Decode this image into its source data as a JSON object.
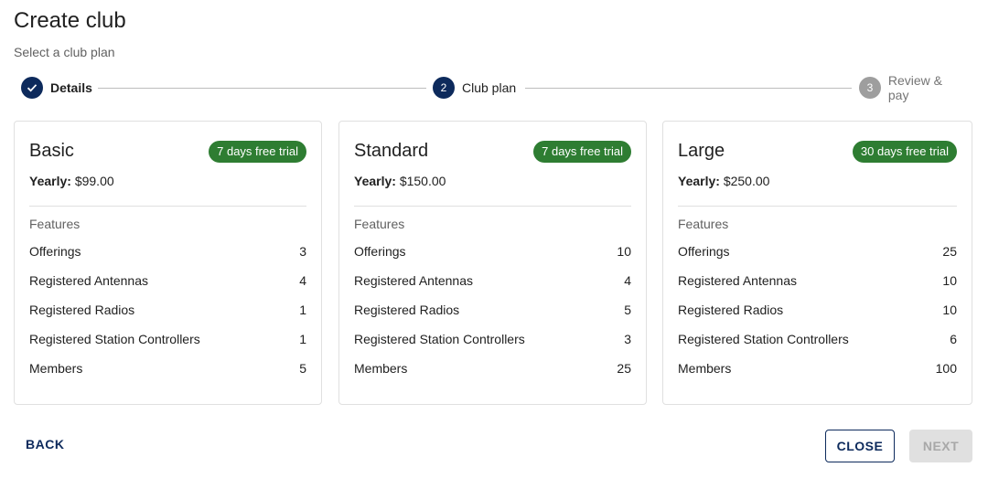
{
  "header": {
    "title": "Create club",
    "subtitle": "Select a club plan"
  },
  "stepper": {
    "steps": [
      {
        "label": "Details",
        "number": "1",
        "state": "completed"
      },
      {
        "label": "Club plan",
        "number": "2",
        "state": "active"
      },
      {
        "label": "Review & pay",
        "number": "3",
        "state": "upcoming"
      }
    ]
  },
  "plans": [
    {
      "name": "Basic",
      "badge": "7 days free trial",
      "price_label": "Yearly:",
      "price": "$99.00",
      "features_label": "Features",
      "features": [
        {
          "label": "Offerings",
          "value": "3"
        },
        {
          "label": "Registered Antennas",
          "value": "4"
        },
        {
          "label": "Registered Radios",
          "value": "1"
        },
        {
          "label": "Registered Station Controllers",
          "value": "1"
        },
        {
          "label": "Members",
          "value": "5"
        }
      ]
    },
    {
      "name": "Standard",
      "badge": "7 days free trial",
      "price_label": "Yearly:",
      "price": "$150.00",
      "features_label": "Features",
      "features": [
        {
          "label": "Offerings",
          "value": "10"
        },
        {
          "label": "Registered Antennas",
          "value": "4"
        },
        {
          "label": "Registered Radios",
          "value": "5"
        },
        {
          "label": "Registered Station Controllers",
          "value": "3"
        },
        {
          "label": "Members",
          "value": "25"
        }
      ]
    },
    {
      "name": "Large",
      "badge": "30 days free trial",
      "price_label": "Yearly:",
      "price": "$250.00",
      "features_label": "Features",
      "features": [
        {
          "label": "Offerings",
          "value": "25"
        },
        {
          "label": "Registered Antennas",
          "value": "10"
        },
        {
          "label": "Registered Radios",
          "value": "10"
        },
        {
          "label": "Registered Station Controllers",
          "value": "6"
        },
        {
          "label": "Members",
          "value": "100"
        }
      ]
    }
  ],
  "actions": {
    "back": "BACK",
    "close": "CLOSE",
    "next": "NEXT"
  },
  "colors": {
    "primary": "#0d2a5c",
    "badge": "#2e7d32",
    "disabled_bg": "#e0e0e0"
  }
}
